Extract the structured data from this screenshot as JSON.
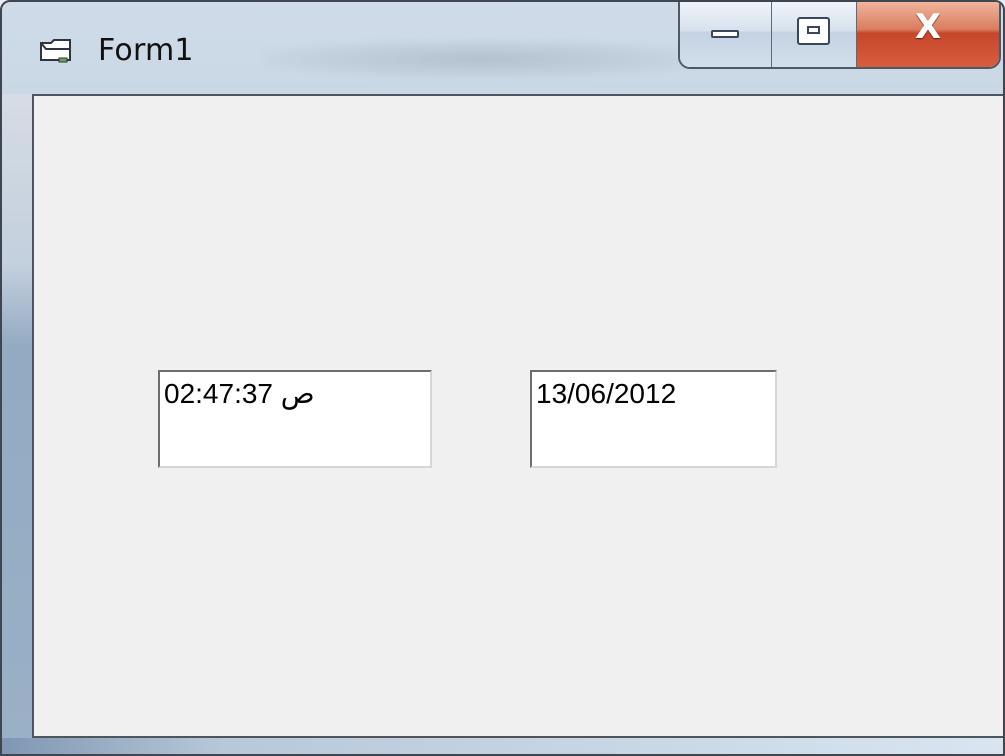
{
  "window": {
    "title": "Form1",
    "icon": "form-icon",
    "controls": {
      "minimize_icon": "minimize-icon",
      "maximize_icon": "maximize-icon",
      "close_icon": "close-icon",
      "close_label": "X"
    }
  },
  "form": {
    "time_text": "02:47:37 ص",
    "date_text": "13/06/2012"
  },
  "colors": {
    "client_background": "#f0f0f0",
    "textbox_background": "#ffffff",
    "close_button_red": "#c6462a"
  }
}
